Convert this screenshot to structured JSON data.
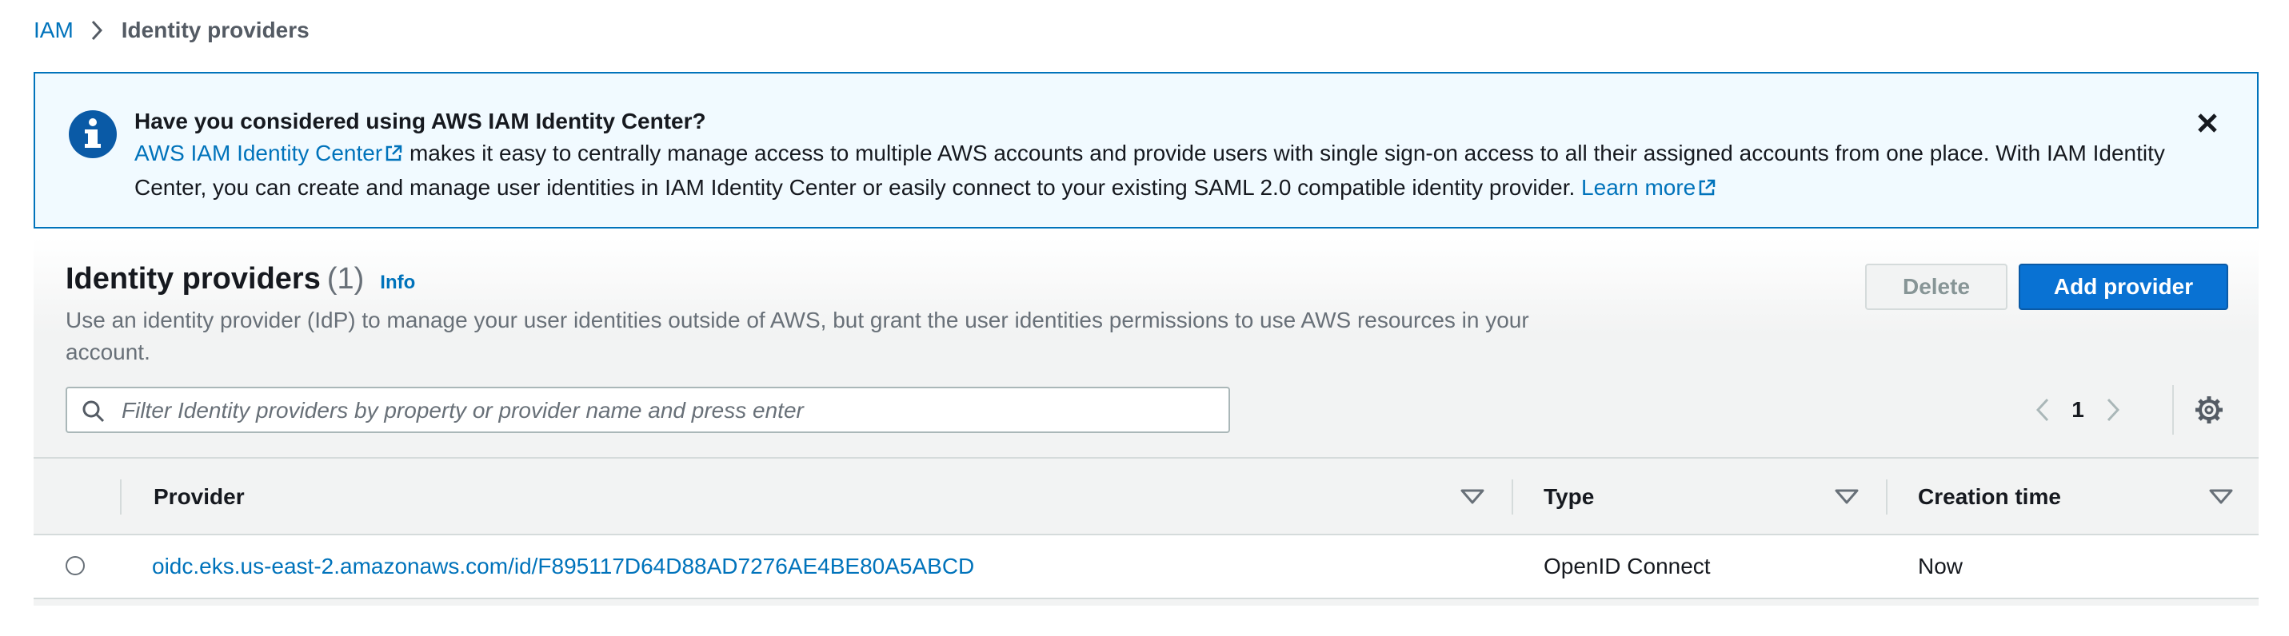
{
  "breadcrumb": {
    "root": "IAM",
    "current": "Identity providers"
  },
  "banner": {
    "title": "Have you considered using AWS IAM Identity Center?",
    "link_text": "AWS IAM Identity Center",
    "body_text": " makes it easy to centrally manage access to multiple AWS accounts and provide users with single sign-on access to all their assigned accounts from one place. With IAM Identity Center, you can create and manage user identities in IAM Identity Center or easily connect to your existing SAML 2.0 compatible identity provider. ",
    "learn_more": "Learn more",
    "icons": {
      "info": "info-icon",
      "external": "external-link-icon",
      "close": "close-icon"
    }
  },
  "panel": {
    "title": "Identity providers",
    "count": "(1)",
    "info_link": "Info",
    "description": "Use an identity provider (IdP) to manage your user identities outside of AWS, but grant the user identities permissions to use AWS resources in your account.",
    "delete_label": "Delete",
    "add_label": "Add provider",
    "filter_placeholder": "Filter Identity providers by property or provider name and press enter",
    "page_number": "1"
  },
  "table": {
    "columns": [
      "Provider",
      "Type",
      "Creation time"
    ],
    "rows": [
      {
        "provider": "oidc.eks.us-east-2.amazonaws.com/id/F895117D64D88AD7276AE4BE80A5ABCD",
        "type": "OpenID Connect",
        "creation_time": "Now"
      }
    ]
  },
  "colors": {
    "link": "#0073bb",
    "primary_button": "#0972d3",
    "banner_bg": "#f1faff",
    "banner_border": "#0073bb"
  }
}
